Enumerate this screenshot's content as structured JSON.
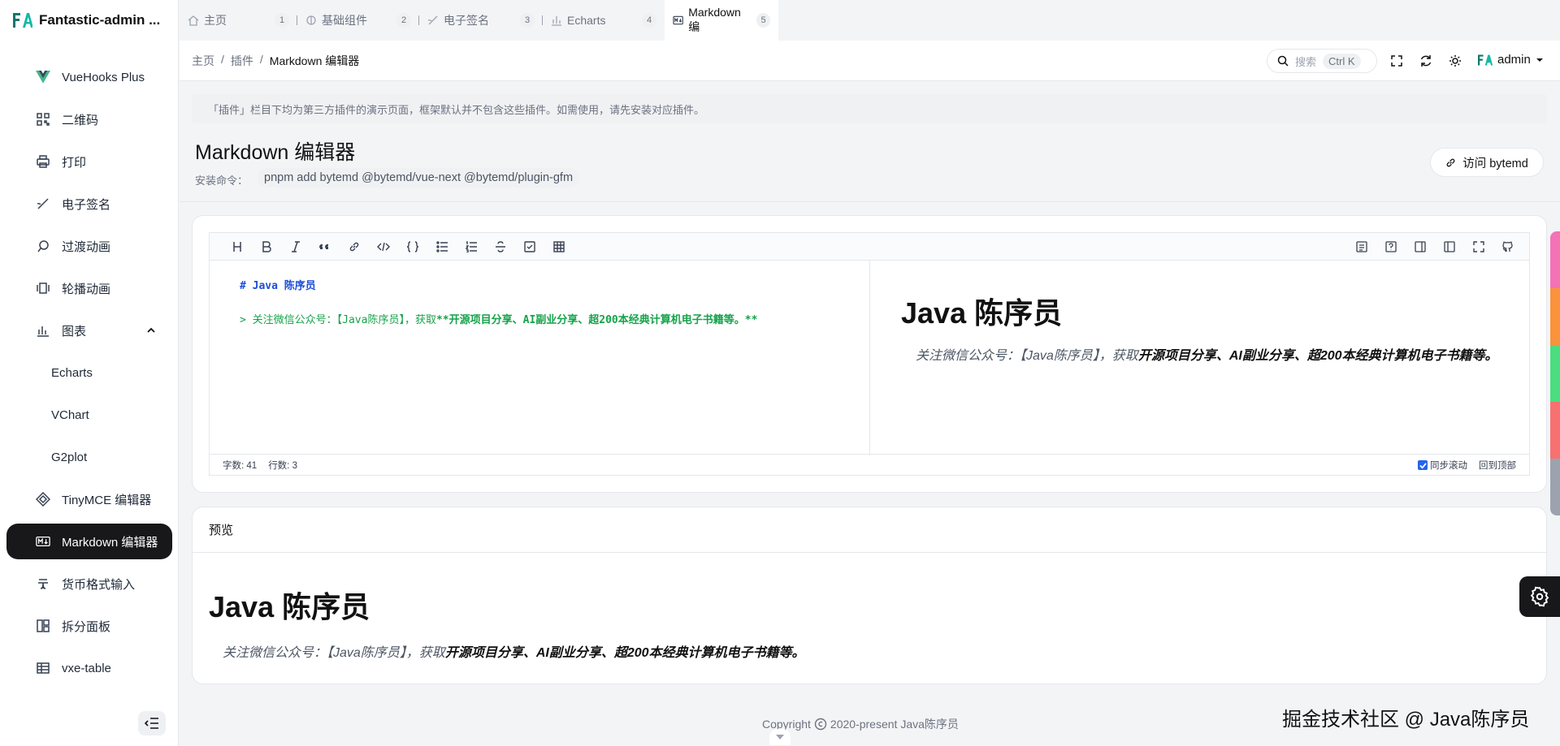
{
  "app": {
    "name": "Fantastic-admin ..."
  },
  "sidebar": {
    "items": [
      {
        "label": "VueHooks Plus",
        "icon": "vue-icon"
      },
      {
        "label": "二维码",
        "icon": "qrcode-icon"
      },
      {
        "label": "打印",
        "icon": "printer-icon"
      },
      {
        "label": "电子签名",
        "icon": "signature-icon"
      },
      {
        "label": "过渡动画",
        "icon": "transition-icon"
      },
      {
        "label": "轮播动画",
        "icon": "carousel-icon"
      },
      {
        "label": "图表",
        "icon": "chart-icon"
      },
      {
        "label": "Echarts"
      },
      {
        "label": "VChart"
      },
      {
        "label": "G2plot"
      },
      {
        "label": "TinyMCE 编辑器",
        "icon": "tinymce-icon"
      },
      {
        "label": "Markdown 编辑器",
        "icon": "markdown-icon"
      },
      {
        "label": "货币格式输入",
        "icon": "currency-icon"
      },
      {
        "label": "拆分面板",
        "icon": "split-panel-icon"
      },
      {
        "label": "vxe-table",
        "icon": "table-icon"
      }
    ]
  },
  "tabs": [
    {
      "label": "主页",
      "index": "1",
      "icon": "home-icon"
    },
    {
      "label": "基础组件",
      "index": "2",
      "icon": "component-icon"
    },
    {
      "label": "电子签名",
      "index": "3",
      "icon": "signature-icon"
    },
    {
      "label": "Echarts",
      "index": "4",
      "icon": "chart-icon"
    },
    {
      "label": "Markdown 编",
      "index": "5",
      "icon": "markdown-icon"
    }
  ],
  "breadcrumb": {
    "home": "主页",
    "sep": "/",
    "plugins": "插件",
    "current": "Markdown 编辑器"
  },
  "search": {
    "placeholder": "搜索",
    "shortcut": "Ctrl K"
  },
  "user": {
    "name": "admin"
  },
  "notice": "「插件」栏目下均为第三方插件的演示页面，框架默认并不包含这些插件。如需使用，请先安装对应插件。",
  "page": {
    "title": "Markdown 编辑器",
    "install_label": "安装命令：",
    "install_cmd": "pnpm add bytemd @bytemd/vue-next @bytemd/plugin-gfm",
    "visit_label": "访问 bytemd"
  },
  "editor": {
    "source_line1": "# Java 陈序员",
    "source_line2_prefix": "> 关注微信公众号：【Java陈序员】，获取",
    "source_line2_bold": "**开源项目分享、AI副业分享、超200本经典计算机电子书籍等。**",
    "preview_title": "Java 陈序员",
    "preview_quote_prefix": "关注微信公众号：【Java陈序员】，获取",
    "preview_quote_bold": "开源项目分享、AI副业分享、超200本经典计算机电子书籍等。",
    "status_words": "字数: 41",
    "status_lines": "行数: 3",
    "sync_scroll": "同步滚动",
    "back_top": "回到顶部"
  },
  "preview": {
    "heading": "预览",
    "title": "Java 陈序员",
    "quote_prefix": "关注微信公众号：【Java陈序员】，获取",
    "quote_bold": "开源项目分享、AI副业分享、超200本经典计算机电子书籍等。"
  },
  "footer": {
    "copyright": "Copyright",
    "text": "2020-present  Java陈序员"
  },
  "watermark": "掘金技术社区 @ Java陈序员",
  "colors": {
    "accent": "#18181b",
    "theme_strip": [
      "#f472b6",
      "#fb923c",
      "#4ade80",
      "#f87171",
      "#9ca3af"
    ]
  }
}
